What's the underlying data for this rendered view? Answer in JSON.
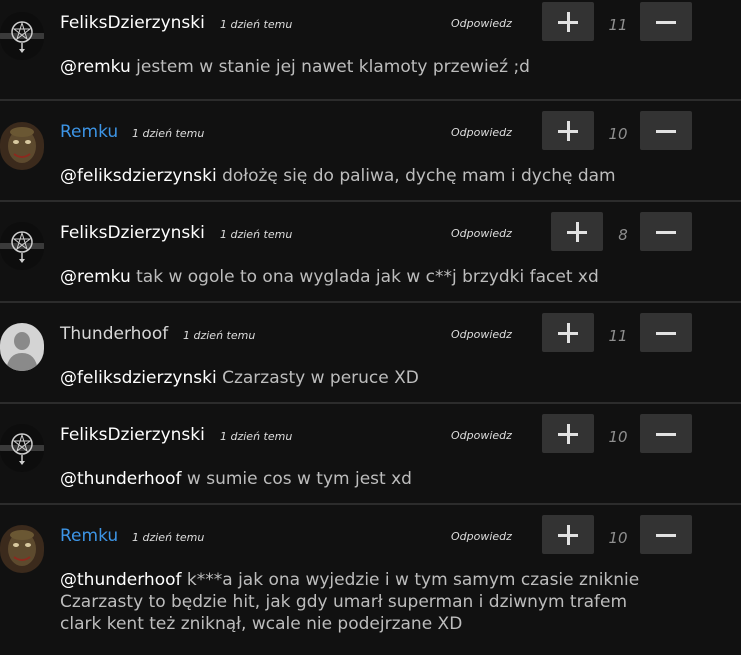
{
  "reply_label": "Odpowiedz",
  "comments": [
    {
      "author": "FeliksDzierzynski",
      "time": "1 dzień temu",
      "score": "11",
      "mention": "@remku",
      "text": " jestem w stanie jej nawet klamoty przewieź ;d"
    },
    {
      "author": "Remku",
      "time": "1 dzień temu",
      "score": "10",
      "mention": "@feliksdzierzynski",
      "text": " dołożę się do paliwa, dychę mam i dychę dam"
    },
    {
      "author": "FeliksDzierzynski",
      "time": "1 dzień temu",
      "score": "8",
      "mention": "@remku",
      "text": " tak w ogole to ona wyglada jak w c**j brzydki facet xd"
    },
    {
      "author": "Thunderhoof",
      "time": "1 dzień temu",
      "score": "11",
      "mention": "@feliksdzierzynski",
      "text": " Czarzasty w peruce XD"
    },
    {
      "author": "FeliksDzierzynski",
      "time": "1 dzień temu",
      "score": "10",
      "mention": "@thunderhoof",
      "text": " w sumie cos w tym jest xd"
    },
    {
      "author": "Remku",
      "time": "1 dzień temu",
      "score": "10",
      "mention": "@thunderhoof",
      "text": " k***a jak ona wyjedzie i w tym samym czasie zniknie Czarzasty to będzie hit, jak gdy umarł superman i dziwnym trafem clark kent też zniknął, wcale nie podejrzane XD"
    }
  ],
  "colors": {
    "background": "#111111",
    "button": "#333333",
    "link_blue": "#3d95e6"
  }
}
